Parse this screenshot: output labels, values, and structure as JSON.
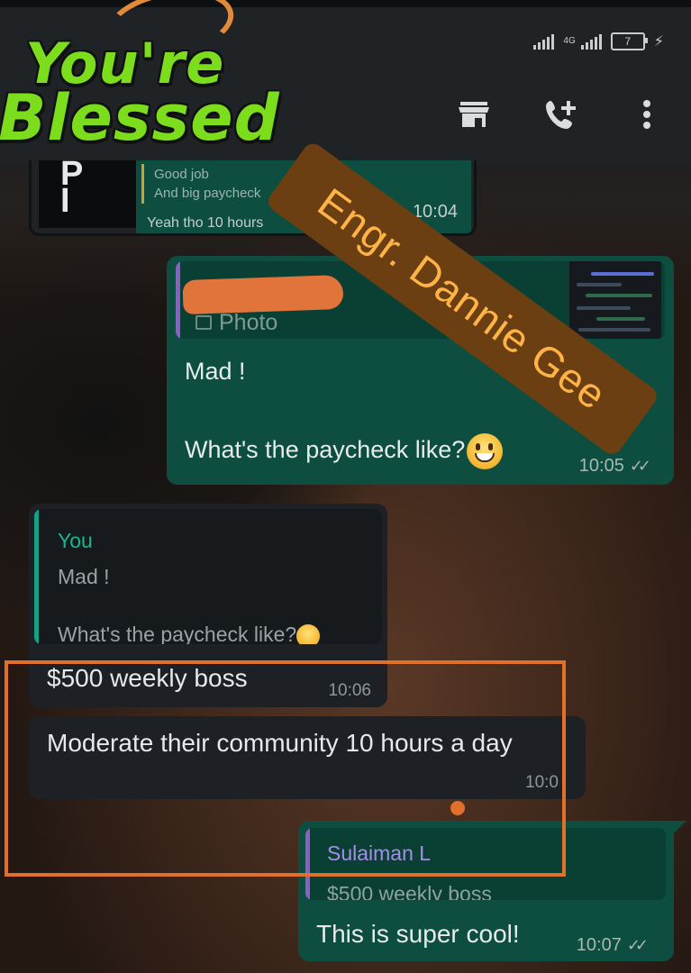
{
  "overlay": {
    "logo_line1": "You're",
    "logo_line2": "Blessed",
    "watermark": "Engr. Dannie Gee",
    "watermark_color": "#6b3f12",
    "highlight_color": "#e0702c"
  },
  "status_bar": {
    "network": "4G",
    "battery": "7"
  },
  "app_bar": {
    "icons": [
      "store-icon",
      "add-call-icon",
      "more-vert-icon"
    ]
  },
  "messages": [
    {
      "id": "m1",
      "side": "outgoing",
      "quote_lines": [
        "Good job",
        "And big paycheck"
      ],
      "text": "Yeah tho 10 hours",
      "time": "10:04"
    },
    {
      "id": "m2",
      "side": "outgoing",
      "quote_label": "Photo",
      "text_line1": "Mad !",
      "text_line2": "What's the paycheck like?",
      "time": "10:05"
    },
    {
      "id": "m3",
      "side": "incoming",
      "quote_author": "You",
      "quote_line1": "Mad !",
      "quote_line2": "What's the paycheck like?",
      "text": "$500 weekly boss",
      "time": "10:06"
    },
    {
      "id": "m4",
      "side": "incoming",
      "text": "Moderate their community 10 hours a day",
      "time": "10:0"
    },
    {
      "id": "m5",
      "side": "outgoing",
      "quote_author": "Sulaiman L",
      "quote_line1": "$500 weekly boss",
      "text": "This is super cool!",
      "time": "10:07"
    }
  ],
  "colors": {
    "outgoing_bubble": "#0d4e40",
    "incoming_bubble": "#1d2125",
    "you_quote_accent": "#16a085",
    "other_quote_accent": "#8b5fc4"
  }
}
